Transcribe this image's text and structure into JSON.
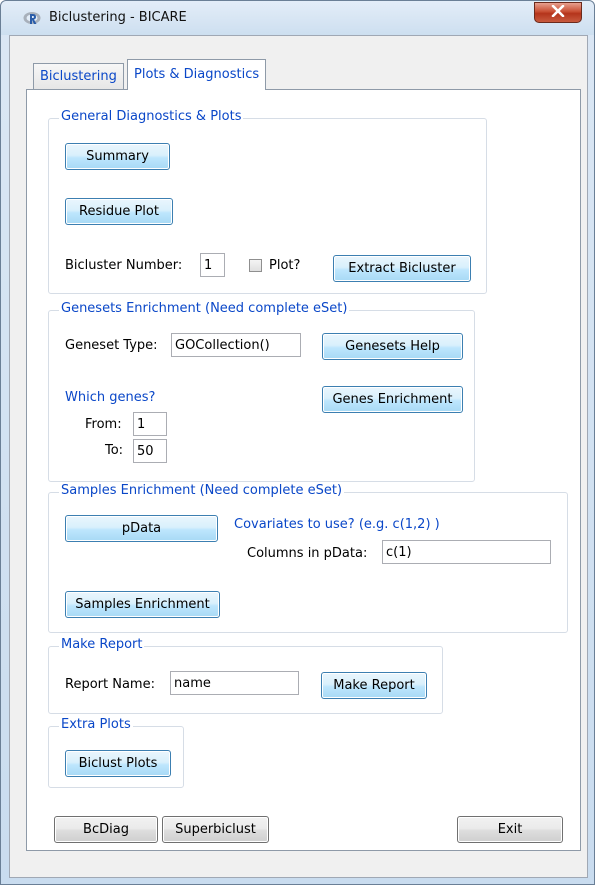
{
  "window": {
    "title": "Biclustering - BICARE"
  },
  "tabs": [
    {
      "label": "Biclustering"
    },
    {
      "label": "Plots & Diagnostics"
    }
  ],
  "general": {
    "legend": "General Diagnostics & Plots",
    "summary_button": "Summary",
    "residue_button": "Residue Plot",
    "bicluster_number_label": "Bicluster Number:",
    "bicluster_number_value": "1",
    "plot_label": "Plot?",
    "extract_button": "Extract Bicluster"
  },
  "genesets": {
    "legend": "Genesets Enrichment (Need complete eSet)",
    "type_label": "Geneset Type:",
    "type_value": "GOCollection()",
    "help_button": "Genesets Help",
    "which_genes_label": "Which genes?",
    "from_label": "From:",
    "from_value": "1",
    "to_label": "To:",
    "to_value": "50",
    "enrichment_button": "Genes Enrichment"
  },
  "samples": {
    "legend": "Samples Enrichment (Need complete eSet)",
    "pdata_button": "pData",
    "covariates_label": "Covariates to use? (e.g. c(1,2) )",
    "columns_label": "Columns in pData:",
    "columns_value": "c(1)",
    "enrichment_button": "Samples Enrichment"
  },
  "report": {
    "legend": "Make Report",
    "name_label": "Report Name:",
    "name_value": "name",
    "make_button": "Make Report"
  },
  "extra": {
    "legend": "Extra Plots",
    "biclust_button": "Biclust Plots"
  },
  "footer": {
    "bcdiag_button": "BcDiag",
    "superbiclust_button": "Superbiclust",
    "exit_button": "Exit"
  },
  "colors": {
    "accent": "#0a47c8",
    "button_border": "#3c7fb1",
    "close_red": "#c94f34"
  },
  "icons": {
    "app": "r-logo-icon",
    "close": "close-icon"
  }
}
